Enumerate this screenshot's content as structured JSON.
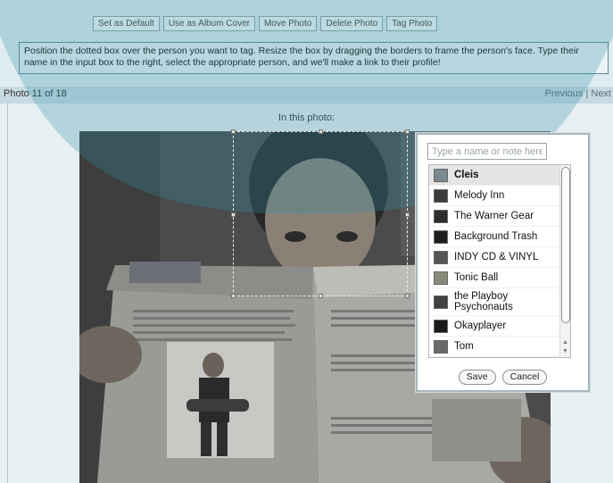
{
  "toolbar": {
    "buttons": [
      "Set as Default",
      "Use as Album Cover",
      "Move Photo",
      "Delete Photo",
      "Tag Photo"
    ]
  },
  "instructions": "Position the dotted box over the person you want to tag. Resize the box by dragging the borders to frame the person's face. Type their name in the input box to the right, select the appropriate person, and we'll make a link to their profile!",
  "photo_bar": {
    "counter": "Photo 11 of 18",
    "previous": "Previous",
    "separator": "|",
    "next": "Next"
  },
  "in_this_photo": "In this photo:",
  "tagger": {
    "placeholder": "Type a name or note here...",
    "friends": [
      {
        "name": "Cleis",
        "selected": true,
        "avatar_color": "#7a8a90"
      },
      {
        "name": "Melody Inn",
        "avatar_color": "#3b3b3b"
      },
      {
        "name": "The Warner Gear",
        "avatar_color": "#2d2d2d"
      },
      {
        "name": "Background Trash",
        "avatar_color": "#1f1f1f"
      },
      {
        "name": "INDY CD & VINYL",
        "avatar_color": "#555555"
      },
      {
        "name": "Tonic Ball",
        "avatar_color": "#8a8a7a"
      },
      {
        "name": "the Playboy Psychonauts",
        "avatar_color": "#404040"
      },
      {
        "name": "Okayplayer",
        "avatar_color": "#1a1a1a"
      },
      {
        "name": "Tom",
        "avatar_color": "#6a6a6a"
      }
    ],
    "save": "Save",
    "cancel": "Cancel"
  },
  "colors": {
    "accent_bar": "#c7dbe2",
    "instruction_border": "#5a8a9a",
    "watermark": "#2e8ea6"
  }
}
